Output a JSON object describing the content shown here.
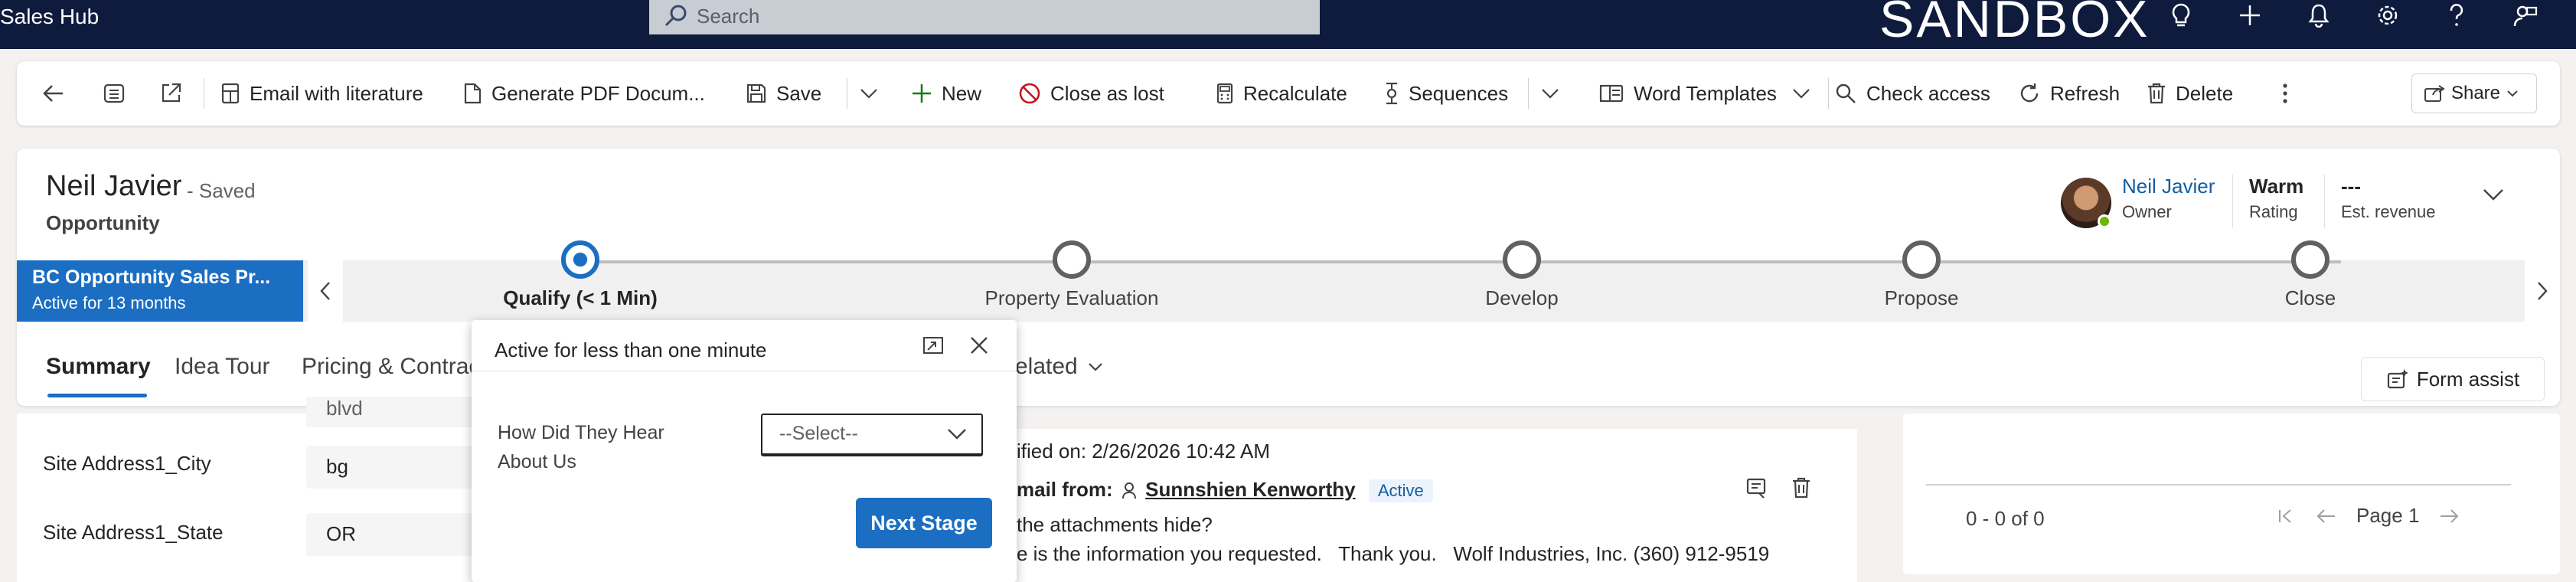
{
  "app": {
    "title": "Sales Hub",
    "environment": "SANDBOX"
  },
  "search": {
    "placeholder": "Search"
  },
  "topbar_icons": [
    "lightbulb-icon",
    "plus-icon",
    "bell-icon",
    "gear-icon",
    "help-icon",
    "person-feedback-icon"
  ],
  "commands": {
    "email_literature": "Email with literature",
    "generate_pdf": "Generate PDF Docum...",
    "save": "Save",
    "new": "New",
    "close_as_lost": "Close as lost",
    "recalculate": "Recalculate",
    "sequences": "Sequences",
    "word_templates": "Word Templates",
    "check_access": "Check access",
    "refresh": "Refresh",
    "delete": "Delete",
    "share": "Share"
  },
  "record": {
    "name": "Neil Javier",
    "status": "- Saved",
    "entity": "Opportunity",
    "owner_name": "Neil Javier",
    "owner_label": "Owner",
    "rating_value": "Warm",
    "rating_label": "Rating",
    "revenue_value": "---",
    "revenue_label": "Est. revenue"
  },
  "bpf": {
    "name": "BC Opportunity Sales Pr...",
    "active_for": "Active for 13 months",
    "stages": [
      "Qualify  (< 1 Min)",
      "Property Evaluation",
      "Develop",
      "Propose",
      "Close"
    ]
  },
  "tabs": {
    "summary": "Summary",
    "idea_tour": "Idea Tour",
    "pricing": "Pricing & Contrac",
    "related": "elated",
    "form_assist": "Form assist"
  },
  "fields": {
    "partial_value": "blvd",
    "city_label": "Site Address1_City",
    "city_value": "bg",
    "state_label": "Site Address1_State",
    "state_value": "OR"
  },
  "timeline": {
    "modified": "ified on: 2/26/2026 10:42 AM",
    "email_prefix": "mail from:",
    "sender": "Sunnshien Kenworthy",
    "badge": "Active",
    "question": "the attachments hide?",
    "body": "e is the information you requested.   Thank you.   Wolf Industries, Inc. (360) 912-9519"
  },
  "subgrid": {
    "count": "0 - 0 of 0",
    "page": "Page 1"
  },
  "flyout": {
    "title": "Active for less than one minute",
    "question": "How Did They Hear About Us",
    "select_value": "--Select--",
    "next_stage": "Next Stage"
  }
}
